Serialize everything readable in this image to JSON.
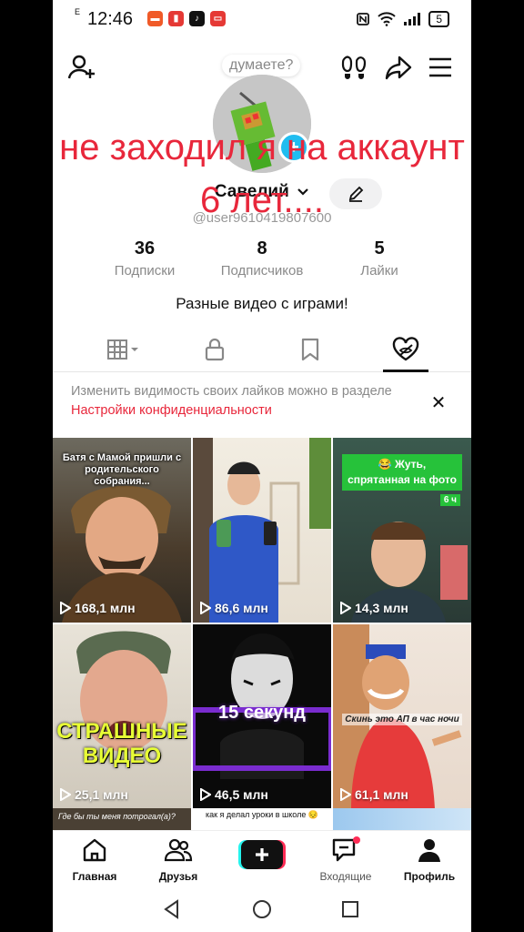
{
  "status_bar": {
    "time": "12:46",
    "network": "E",
    "battery": "5"
  },
  "profile": {
    "note_bubble": "думаете?",
    "overlay_line1": "не заходил я на аккаунт",
    "overlay_line2": "6 лет....",
    "name": "Савелий",
    "handle": "@user9610419807600",
    "bio": "Разные видео с играми!",
    "stats": [
      {
        "value": "36",
        "label": "Подписки"
      },
      {
        "value": "8",
        "label": "Подписчиков"
      },
      {
        "value": "5",
        "label": "Лайки"
      }
    ]
  },
  "notice": {
    "text": "Изменить видимость своих лайков можно в разделе ",
    "link": "Настройки конфиденциальности"
  },
  "videos": [
    {
      "views": "168,1 млн",
      "caption": "Батя с Мамой пришли с родительского собрания..."
    },
    {
      "views": "86,6 млн",
      "caption": ""
    },
    {
      "views": "14,3 млн",
      "caption": "😂 Жуть, спрятанная на фото",
      "time": "6 ч"
    },
    {
      "views": "25,1 млн",
      "caption": "СТРАШНЫЕ ВИДЕО"
    },
    {
      "views": "46,5 млн",
      "caption": "15 секунд"
    },
    {
      "views": "61,1 млн",
      "caption": "Скинь это АП в час ночи"
    }
  ],
  "partial_captions": [
    "Где бы ты меня потрогал(а)?",
    "как я делал уроки в школе 😔"
  ],
  "nav": {
    "home": "Главная",
    "friends": "Друзья",
    "inbox": "Входящие",
    "profile": "Профиль"
  },
  "colors": {
    "accent": "#e8273b",
    "tiktok_cyan": "#25f4ee",
    "tiktok_pink": "#fe2c55",
    "avatar_badge": "#20bdf0"
  }
}
